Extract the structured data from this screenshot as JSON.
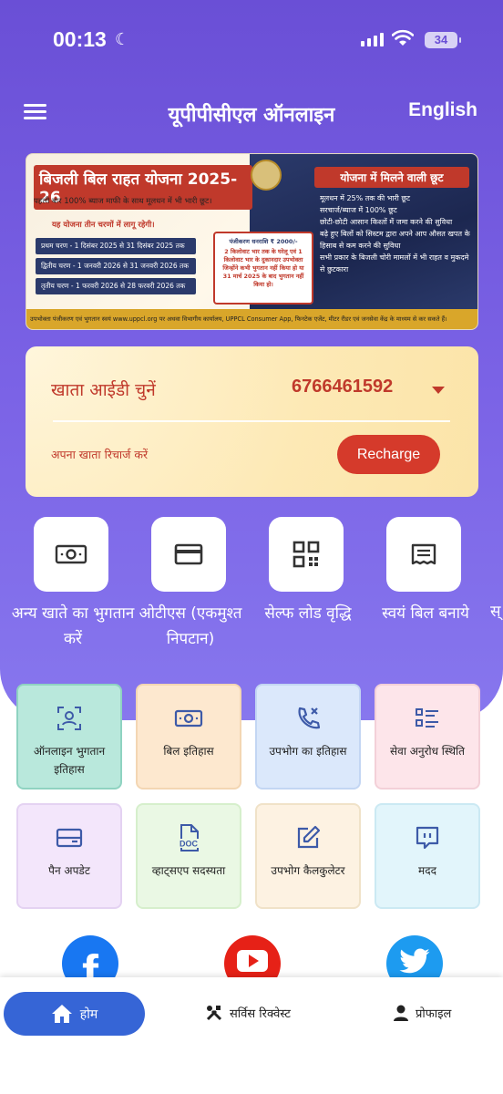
{
  "status_bar": {
    "time": "00:13",
    "battery": "34"
  },
  "header": {
    "title": "यूपीपीसीएल ऑनलाइन",
    "language_toggle": "English"
  },
  "banner": {
    "title": "बिजली बिल राहत योजना 2025-26",
    "subtitle": "पहली बार 100% ब्याज माफी के साथ मूलधन में भी भारी छूट।",
    "subtitle2": "यह योजना तीन चरणों में लागू रहेगी।",
    "phases": [
      "प्रथम चरण - 1 दिसंबर 2025 से 31 दिसंबर 2025 तक",
      "द्वितीय चरण - 1 जनवरी 2026 से 31 जनवरी 2026 तक",
      "तृतीय चरण - 1 फरवरी 2026 से 28 फरवरी 2026 तक"
    ],
    "registration_fee": "पंजीकरण धनराशि ₹ 2000/-",
    "eligibility": "2 किलोवाट भार तक के घरेलू एवं 1 किलोवाट भार के दुकानदार उपभोक्ता जिन्होंने कभी भुगतान नहीं किया हो या 31 मार्च 2025 के बाद भुगतान नहीं किया हो।",
    "benefits_heading": "योजना में मिलने वाली छूट",
    "benefits": [
      "मूलधन में 25% तक की भारी छूट",
      "सरचार्ज/ब्याज में 100% छूट",
      "छोटी-छोटी आसान किश्तों में जमा करने की सुविधा",
      "बढ़े हुए बिलों को सिस्टम द्वारा अपने आप औसत खपत के हिसाब से कम करने की सुविधा",
      "सभी प्रकार के बिजली चोरी मामलों में भी राहत व मुकदमे से छुटकारा"
    ],
    "footer": "उपभोक्ता पंजीकरण एवं भुगतान स्वयं www.uppcl.org पर अथवा विभागीय कार्यालय, UPPCL Consumer App, फिनटेक एजेंट, मीटर रीडर एवं जनसेवा केंद्र के माध्यम से कर सकते हैं।"
  },
  "account": {
    "label": "खाता आईडी चुनें",
    "selected_id": "6766461592",
    "recharge_text": "अपना खाता रिचार्ज करें",
    "recharge_button": "Recharge"
  },
  "quick_actions": [
    {
      "label": "अन्य खाते का भुगतान करें",
      "icon": "cash-icon"
    },
    {
      "label": "ओटीएस (एकमुश्त निपटान)",
      "icon": "card-icon"
    },
    {
      "label": "सेल्फ लोड वृद्धि",
      "icon": "qr-code-icon"
    },
    {
      "label": "स्वयं बिल बनाये",
      "icon": "receipt-icon"
    },
    {
      "label": "स्"
    }
  ],
  "services": [
    {
      "label": "ऑनलाइन भुगतान इतिहास",
      "icon": "user-scan-icon",
      "bg": "#b9e8dc",
      "border": "#8fd3c1",
      "color": "#3d5aa8"
    },
    {
      "label": "बिल इतिहास",
      "icon": "cash-icon",
      "bg": "#fde8cf",
      "border": "#f3d6b3",
      "color": "#3d5aa8"
    },
    {
      "label": "उपभोग का इतिहास",
      "icon": "phone-missed-icon",
      "bg": "#dbe8fb",
      "border": "#c3d6f3",
      "color": "#3d5aa8"
    },
    {
      "label": "सेवा अनुरोध स्थिति",
      "icon": "list-icon",
      "bg": "#fde5ea",
      "border": "#f3d0d8",
      "color": "#3d5aa8"
    },
    {
      "label": "पैन अपडेट",
      "icon": "card-icon",
      "bg": "#f3e6fb",
      "border": "#e4d2f2",
      "color": "#3d5aa8"
    },
    {
      "label": "व्हाट्सएप सदस्यता",
      "icon": "doc-icon",
      "bg": "#eaf8e4",
      "border": "#d6efcc",
      "color": "#3d5aa8"
    },
    {
      "label": "उपभोग कैलकुलेटर",
      "icon": "edit-icon",
      "bg": "#fdf2e2",
      "border": "#f0e2c8",
      "color": "#3d5aa8"
    },
    {
      "label": "मदद",
      "icon": "chat-icon",
      "bg": "#e2f5fb",
      "border": "#cbe9f3",
      "color": "#3d5aa8"
    }
  ],
  "social": [
    {
      "name": "facebook-icon",
      "color": "#1877f2"
    },
    {
      "name": "youtube-icon",
      "color": "#e62117"
    },
    {
      "name": "twitter-icon",
      "color": "#1d9bf0"
    }
  ],
  "bottom_nav": {
    "home": "होम",
    "service_request": "सर्विस रिक्वेस्ट",
    "profile": "प्रोफाइल"
  },
  "colors": {
    "hero": "#6a4fd6",
    "accent_red": "#c0392b",
    "nav_blue": "#3665d6"
  }
}
